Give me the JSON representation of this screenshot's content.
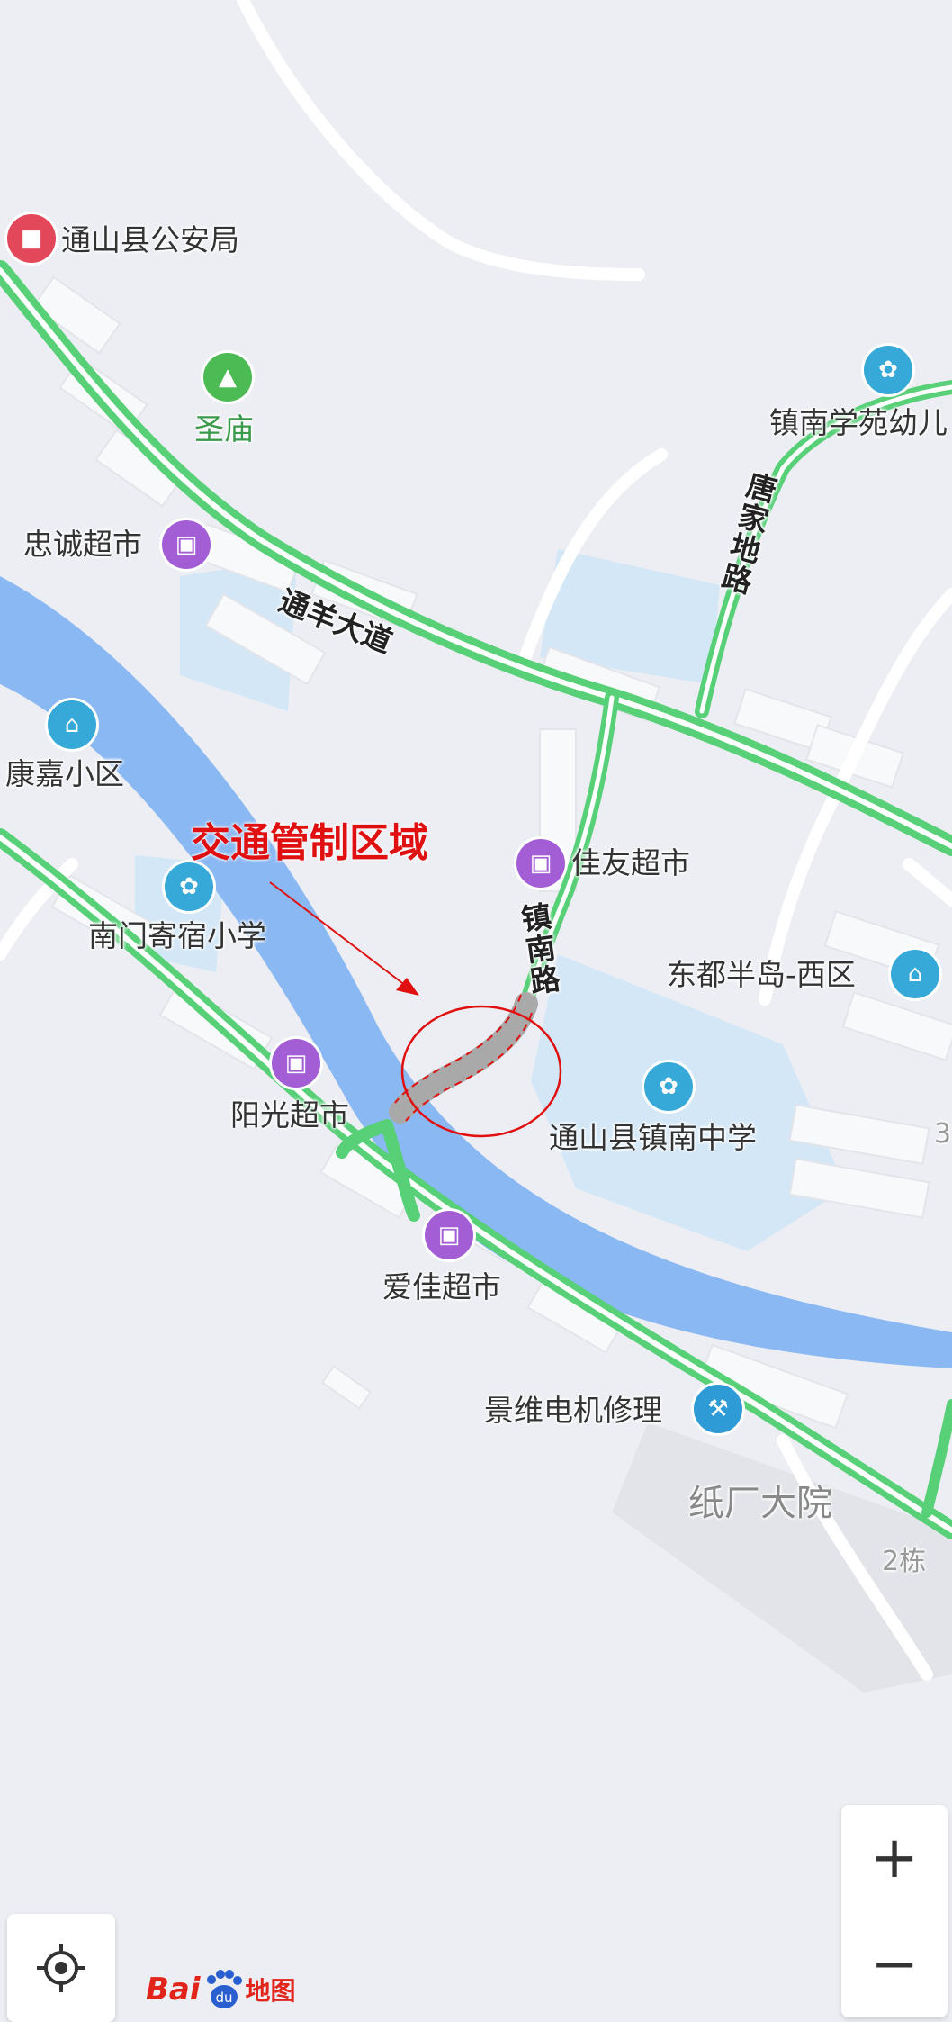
{
  "map": {
    "annotation": {
      "warning_label": "交通管制区域",
      "color": "#e01010"
    },
    "roads": {
      "main_road": "通羊大道",
      "zhennan_road": "镇南路",
      "tangjia_road": "唐家地路"
    },
    "pois": [
      {
        "label": "通山县公安局",
        "icon": "police-icon",
        "color": "#e2475a"
      },
      {
        "label": "圣庙",
        "icon": "tree-icon",
        "color": "#4dbb54"
      },
      {
        "label": "镇南学苑幼儿",
        "icon": "school-icon",
        "color": "#36a9d8"
      },
      {
        "label": "忠诚超市",
        "icon": "shopping-basket-icon",
        "color": "#a35ed6"
      },
      {
        "label": "康嘉小区",
        "icon": "residence-icon",
        "color": "#36a9d8"
      },
      {
        "label": "南门寄宿小学",
        "icon": "school-icon",
        "color": "#36a9d8"
      },
      {
        "label": "佳友超市",
        "icon": "shopping-basket-icon",
        "color": "#a35ed6"
      },
      {
        "label": "东都半岛-西区",
        "icon": "residence-icon",
        "color": "#36a9d8"
      },
      {
        "label": "阳光超市",
        "icon": "shopping-basket-icon",
        "color": "#a35ed6"
      },
      {
        "label": "通山县镇南中学",
        "icon": "school-icon",
        "color": "#36a9d8"
      },
      {
        "label": "爱佳超市",
        "icon": "shopping-basket-icon",
        "color": "#a35ed6"
      },
      {
        "label": "景维电机修理",
        "icon": "wrench-icon",
        "color": "#2f9bd6"
      }
    ],
    "areas": {
      "paper_mill": "纸厂大院",
      "building_2": "2栋",
      "edge_number": "3"
    }
  },
  "controls": {
    "zoom_in": "+",
    "zoom_out": "−",
    "locate_icon": "locate-icon"
  },
  "branding": {
    "logo_bai": "Bai",
    "logo_du": "du",
    "logo_ditu": "地图"
  },
  "colors": {
    "background": "#eceef3",
    "river": "#8ab8f2",
    "road_green": "#57d078",
    "school_area": "#d3e7f6"
  }
}
